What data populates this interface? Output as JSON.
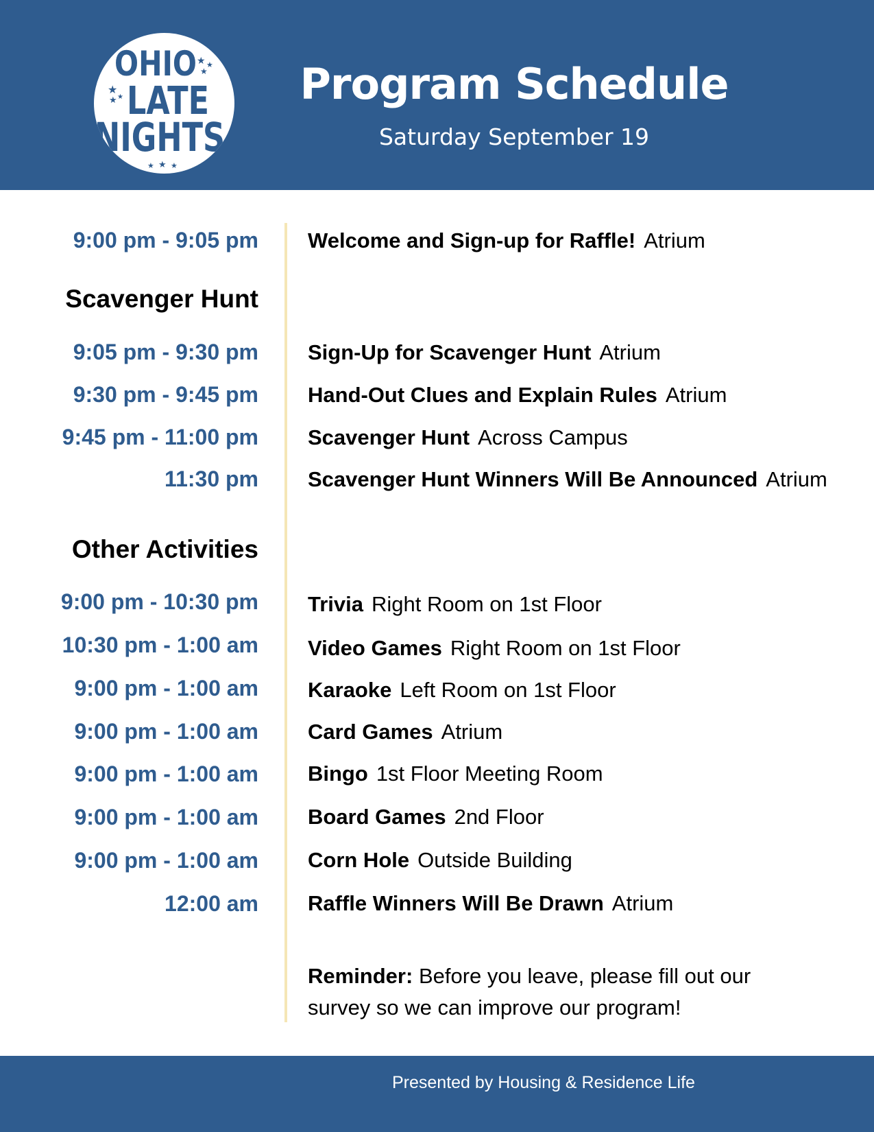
{
  "logo": {
    "line1": "OHIO",
    "line2": "LATE",
    "line3": "NIGHTS"
  },
  "header": {
    "title": "Program Schedule",
    "subtitle": "Saturday September 19"
  },
  "welcome": {
    "time": "9:00 pm - 9:05 pm",
    "name": "Welcome and Sign-up for Raffle!",
    "location": "Atrium"
  },
  "scavenger": {
    "heading": "Scavenger Hunt",
    "items": [
      {
        "time": "9:05 pm - 9:30 pm",
        "name": "Sign-Up for Scavenger Hunt",
        "location": "Atrium"
      },
      {
        "time": "9:30 pm - 9:45 pm",
        "name": "Hand-Out Clues and Explain Rules",
        "location": "Atrium"
      },
      {
        "time": "9:45 pm - 11:00 pm",
        "name": "Scavenger Hunt",
        "location": "Across Campus"
      },
      {
        "time": "11:30 pm",
        "name": "Scavenger Hunt Winners Will Be Announced",
        "location": "Atrium"
      }
    ]
  },
  "other": {
    "heading": "Other Activities",
    "items": [
      {
        "time": "9:00 pm - 10:30 pm",
        "name": "Trivia",
        "location": "Right Room on 1st Floor"
      },
      {
        "time": "10:30 pm - 1:00 am",
        "name": "Video Games",
        "location": "Right Room on 1st Floor"
      },
      {
        "time": "9:00 pm - 1:00 am",
        "name": "Karaoke",
        "location": "Left Room on 1st Floor"
      },
      {
        "time": "9:00 pm - 1:00 am",
        "name": "Card Games",
        "location": "Atrium"
      },
      {
        "time": "9:00 pm - 1:00 am",
        "name": "Bingo",
        "location": "1st Floor Meeting Room"
      },
      {
        "time": "9:00 pm - 1:00 am",
        "name": "Board Games",
        "location": "2nd Floor"
      },
      {
        "time": "9:00 pm - 1:00 am",
        "name": "Corn Hole",
        "location": "Outside Building"
      },
      {
        "time": "12:00 am",
        "name": "Raffle Winners Will Be Drawn",
        "location": "Atrium"
      }
    ]
  },
  "reminder": {
    "label": "Reminder:",
    "line1": "Before you leave, please fill out our",
    "line2": "survey so we can improve our program!"
  },
  "footer": {
    "text": "Presented by Housing & Residence Life"
  },
  "colors": {
    "brand_blue": "#2f5c8f",
    "divider_cream": "#f5e6b6",
    "text": "#000000"
  }
}
